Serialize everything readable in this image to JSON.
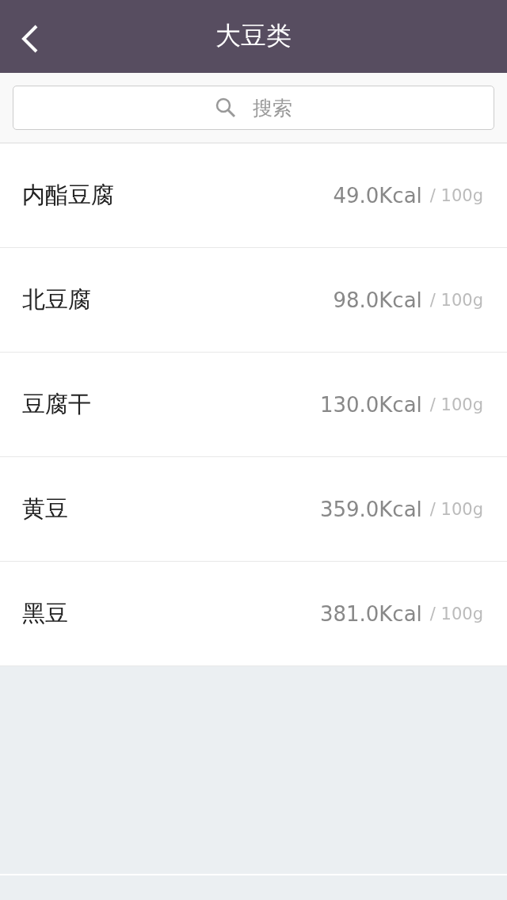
{
  "nav_bar": {
    "title": "大豆类"
  },
  "search": {
    "placeholder": "搜索"
  },
  "foods": [
    {
      "name": "内酯豆腐",
      "calories": "49.0Kcal",
      "unit": "/ 100g"
    },
    {
      "name": "北豆腐",
      "calories": "98.0Kcal",
      "unit": "/ 100g"
    },
    {
      "name": "豆腐干",
      "calories": "130.0Kcal",
      "unit": "/ 100g"
    },
    {
      "name": "黄豆",
      "calories": "359.0Kcal",
      "unit": "/ 100g"
    },
    {
      "name": "黑豆",
      "calories": "381.0Kcal",
      "unit": "/ 100g"
    }
  ]
}
